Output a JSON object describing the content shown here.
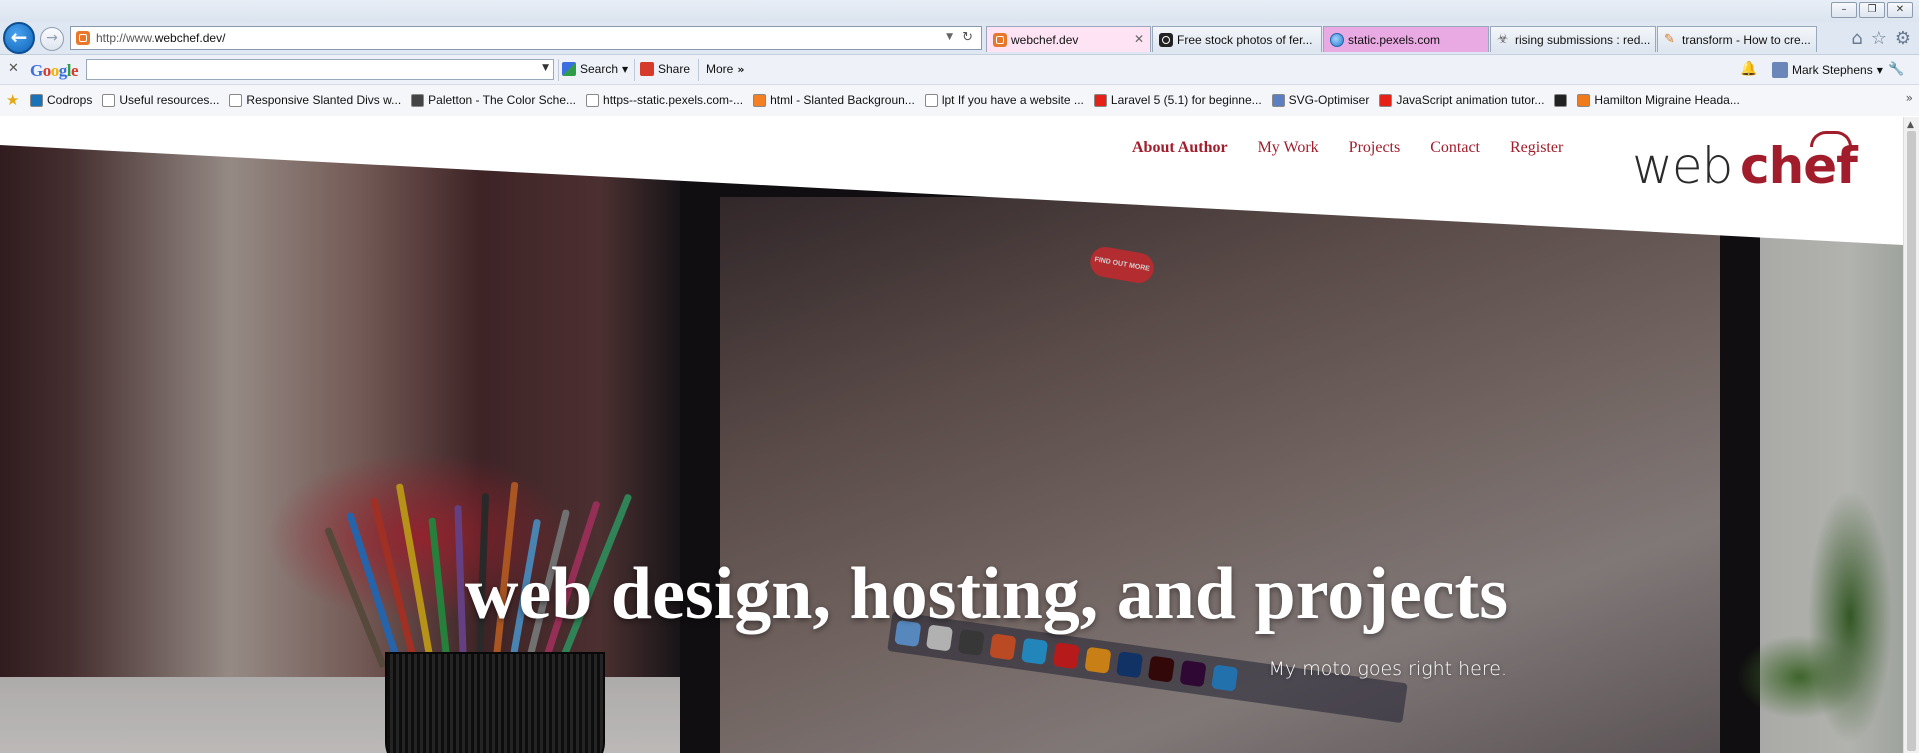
{
  "browser": {
    "address_url_prefix": "http://www.",
    "address_url_domain": "webchef.dev/",
    "tabs": [
      {
        "label": "webchef.dev",
        "state": "active",
        "icon": "webchef-favicon"
      },
      {
        "label": "Free stock photos of fer...",
        "state": "normal",
        "icon": "instagram-icon"
      },
      {
        "label": "static.pexels.com",
        "state": "highlighted",
        "icon": "ie-globe-icon"
      },
      {
        "label": "rising submissions : red...",
        "state": "normal",
        "icon": "reddit-icon"
      },
      {
        "label": "transform - How to cre...",
        "state": "normal",
        "icon": "stackoverflow-icon"
      }
    ],
    "window_buttons": [
      "minimize",
      "restore",
      "close"
    ]
  },
  "toolbar": {
    "google_logo": "Google",
    "search_value": "",
    "search_label": "Search",
    "share_label": "Share",
    "more_label": "More",
    "user_name": "Mark Stephens"
  },
  "favorites": [
    {
      "label": "Codrops",
      "icon": "codrops-icon",
      "color": "#1a73b8"
    },
    {
      "label": "Useful resources...",
      "icon": "page-icon",
      "color": "#ffffff"
    },
    {
      "label": "Responsive Slanted Divs w...",
      "icon": "page-icon",
      "color": "#ffffff"
    },
    {
      "label": "Paletton - The Color Sche...",
      "icon": "paletton-icon",
      "color": "#444444"
    },
    {
      "label": "https--static.pexels.com-...",
      "icon": "page-icon",
      "color": "#ffffff"
    },
    {
      "label": "html - Slanted Backgroun...",
      "icon": "stackoverflow-icon",
      "color": "#f48024"
    },
    {
      "label": "lpt If you have a website ...",
      "icon": "reddit-icon",
      "color": "#ffffff"
    },
    {
      "label": "Laravel 5 (5.1) for beginne...",
      "icon": "youtube-icon",
      "color": "#e62117"
    },
    {
      "label": "SVG-Optimiser",
      "icon": "svg-optimiser-icon",
      "color": "#5b7fc1"
    },
    {
      "label": "JavaScript animation tutor...",
      "icon": "youtube-icon",
      "color": "#e62117"
    },
    {
      "label": "",
      "icon": "wikipedia-icon",
      "color": "#222222"
    },
    {
      "label": "Hamilton Migraine Heada...",
      "icon": "sun-icon",
      "color": "#f07a1a"
    }
  ],
  "site": {
    "nav": [
      {
        "label": "About Author",
        "active": true
      },
      {
        "label": "My Work",
        "active": false
      },
      {
        "label": "Projects",
        "active": false
      },
      {
        "label": "Contact",
        "active": false
      },
      {
        "label": "Register",
        "active": false
      }
    ],
    "logo_web": "web",
    "logo_chef": "chef",
    "hero_title": "web design, hosting, and projects",
    "hero_moto": "My moto goes right here.",
    "photo_button_text": "FIND OUT MORE",
    "brand_color": "#a11d2b"
  }
}
